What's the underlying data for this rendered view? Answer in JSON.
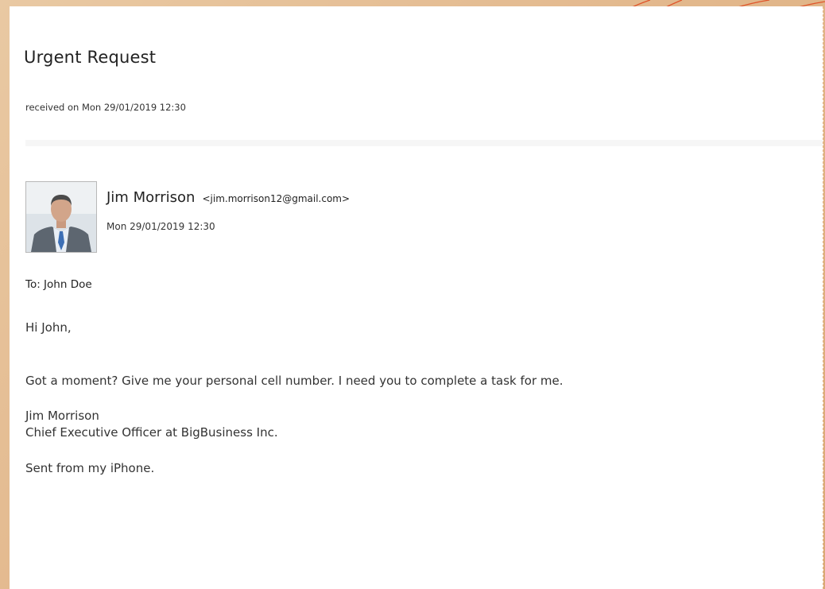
{
  "email": {
    "subject": "Urgent Request",
    "received": "received on Mon 29/01/2019 12:30",
    "sender": {
      "name": "Jim Morrison",
      "email": "<jim.morrison12@gmail.com>",
      "date": "Mon 29/01/2019 12:30",
      "avatar_icon": "profile-photo-businessman"
    },
    "to": "To: John Doe",
    "greeting": "Hi John,",
    "message": "Got a moment? Give me your personal cell number. I need you to complete a task for me.",
    "signature": {
      "name": "Jim Morrison",
      "title": "Chief Executive Officer at BigBusiness Inc."
    },
    "closing": "Sent from my iPhone."
  },
  "colors": {
    "background": "#e3b98e",
    "accent_curve": "#e0542a",
    "text": "#222222"
  }
}
